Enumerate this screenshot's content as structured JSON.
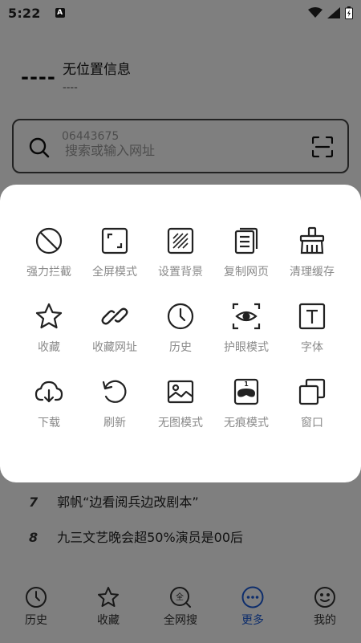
{
  "status": {
    "time": "5:22",
    "badge": "A"
  },
  "header": {
    "temperature": "----",
    "location": "无位置信息",
    "location_sub": "----"
  },
  "search": {
    "ghost_text": "06443675",
    "placeholder": "搜索或输入网址"
  },
  "news": [
    {
      "num": "7",
      "title": "郭帆“边看阅兵边改剧本”"
    },
    {
      "num": "8",
      "title": "九三文艺晚会超50%演员是00后"
    }
  ],
  "menu": {
    "items": [
      {
        "label": "强力拦截",
        "icon": "ban-icon"
      },
      {
        "label": "全屏模式",
        "icon": "fullscreen-icon"
      },
      {
        "label": "设置背景",
        "icon": "background-icon"
      },
      {
        "label": "复制网页",
        "icon": "copy-page-icon"
      },
      {
        "label": "清理缓存",
        "icon": "broom-icon"
      },
      {
        "label": "收藏",
        "icon": "star-icon"
      },
      {
        "label": "收藏网址",
        "icon": "link-icon"
      },
      {
        "label": "历史",
        "icon": "clock-icon"
      },
      {
        "label": "护眼模式",
        "icon": "eye-icon"
      },
      {
        "label": "字体",
        "icon": "font-icon"
      },
      {
        "label": "下载",
        "icon": "cloud-download-icon"
      },
      {
        "label": "刷新",
        "icon": "refresh-icon"
      },
      {
        "label": "无图模式",
        "icon": "image-icon"
      },
      {
        "label": "无痕模式",
        "icon": "incognito-icon"
      },
      {
        "label": "窗口",
        "icon": "windows-icon"
      }
    ]
  },
  "bottom_nav": [
    {
      "label": "历史",
      "icon": "clock-icon"
    },
    {
      "label": "收藏",
      "icon": "star-icon"
    },
    {
      "label": "全网搜",
      "icon": "global-search-icon"
    },
    {
      "label": "更多",
      "icon": "more-icon",
      "active": true
    },
    {
      "label": "我的",
      "icon": "profile-icon"
    }
  ],
  "colors": {
    "accent": "#1a5bd8",
    "overlay": "#808080",
    "label_gray": "#8a8a8a"
  }
}
